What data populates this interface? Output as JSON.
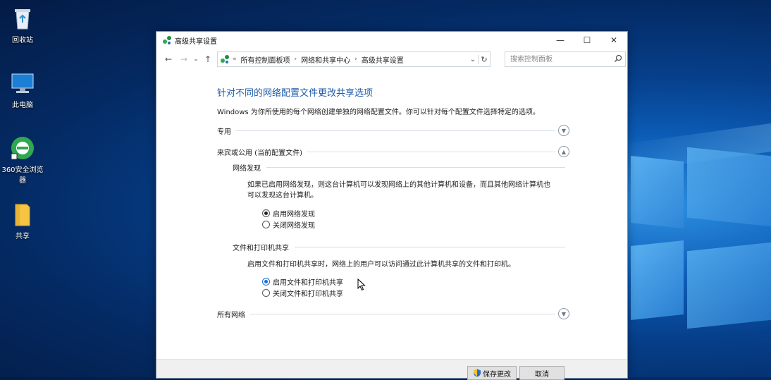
{
  "desktop": {
    "icons": [
      {
        "label": "回收站"
      },
      {
        "label": "此电脑"
      },
      {
        "label": "360安全浏览器"
      },
      {
        "label": "共享"
      }
    ]
  },
  "window": {
    "title": "高级共享设置",
    "controls": {
      "minimize": "—",
      "maximize": "☐",
      "close": "✕"
    },
    "nav": {
      "back": "←",
      "forward": "→",
      "recent": "⌄",
      "up": "↑"
    },
    "address": {
      "overflow": "«",
      "crumbs": [
        "所有控制面板项",
        "网络和共享中心",
        "高级共享设置"
      ],
      "separator": "›",
      "dropdown": "⌄",
      "refresh": "↻"
    },
    "search": {
      "placeholder": "搜索控制面板",
      "value": ""
    },
    "content": {
      "heading": "针对不同的网络配置文件更改共享选项",
      "description": "Windows 为你所使用的每个网络创建单独的网络配置文件。你可以针对每个配置文件选择特定的选项。",
      "sections": {
        "private": {
          "label": "专用",
          "state": "collapsed"
        },
        "guest": {
          "label": "来宾或公用 (当前配置文件)",
          "state": "expanded"
        },
        "all": {
          "label": "所有网络",
          "state": "collapsed"
        }
      },
      "network_discovery": {
        "title": "网络发现",
        "text_line1": "如果已启用网络发现，则这台计算机可以发现网络上的其他计算机和设备，而且其他网络计算机也",
        "text_line2": "可以发现这台计算机。",
        "options": [
          "启用网络发现",
          "关闭网络发现"
        ],
        "selected": 0
      },
      "file_printer_sharing": {
        "title": "文件和打印机共享",
        "text": "启用文件和打印机共享时，网络上的用户可以访问通过此计算机共享的文件和打印机。",
        "options": [
          "启用文件和打印机共享",
          "关闭文件和打印机共享"
        ],
        "selected": 0
      }
    },
    "footer": {
      "save": "保存更改",
      "cancel": "取消"
    }
  },
  "colors": {
    "heading": "#1e5aa8",
    "radio_selected_blue": "#1a6fd0"
  }
}
